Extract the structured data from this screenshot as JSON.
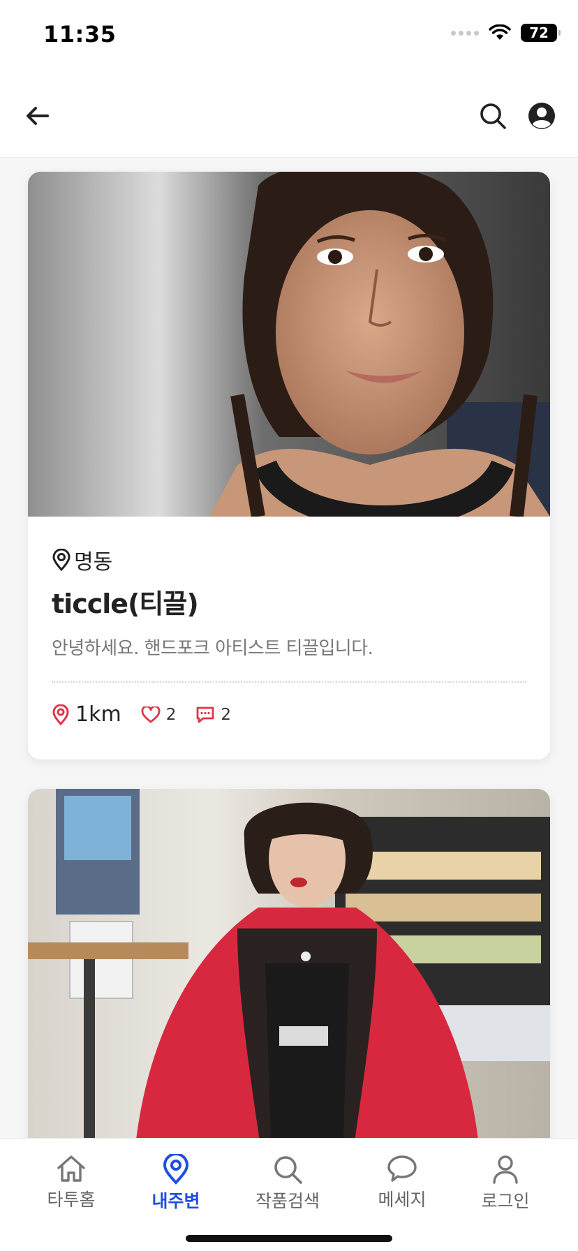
{
  "status_bar": {
    "time": "11:35",
    "battery": "72"
  },
  "header": {
    "back_icon": "arrow-left-icon",
    "search_icon": "search-icon",
    "profile_icon": "user-circle-icon"
  },
  "cards": [
    {
      "location": "명동",
      "title": "ticcle(티끌)",
      "description": "안녕하세요. 핸드포크 아티스트 티끌입니다.",
      "distance": "1km",
      "likes": "2",
      "comments": "2"
    },
    {}
  ],
  "tabs": [
    {
      "label": "타투홈",
      "icon": "home-icon",
      "active": false
    },
    {
      "label": "내주변",
      "icon": "location-pin-icon",
      "active": true
    },
    {
      "label": "작품검색",
      "icon": "search-icon",
      "active": false
    },
    {
      "label": "메세지",
      "icon": "chat-bubble-icon",
      "active": false
    },
    {
      "label": "로그인",
      "icon": "person-icon",
      "active": false
    }
  ],
  "colors": {
    "accent": "#1f4fe0",
    "stat_red": "#e0344a",
    "background": "#f6f6f7"
  }
}
